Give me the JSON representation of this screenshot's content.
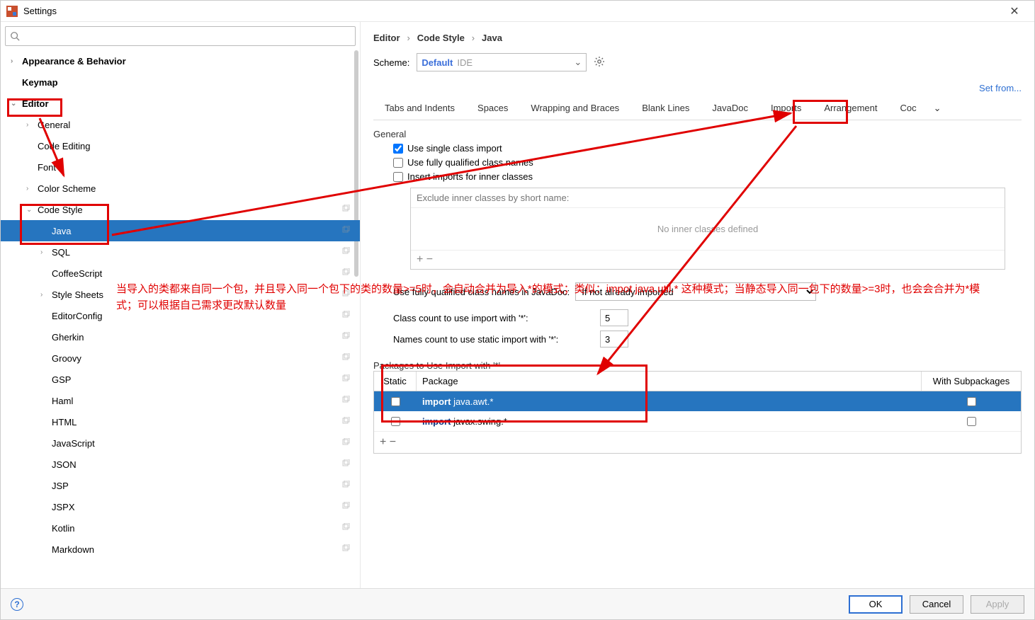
{
  "window": {
    "title": "Settings"
  },
  "search": {
    "placeholder": ""
  },
  "tree": {
    "items": [
      {
        "label": "Appearance & Behavior",
        "indent": 0,
        "chev": "›",
        "bold": true
      },
      {
        "label": "Keymap",
        "indent": 0,
        "chev": "",
        "bold": true
      },
      {
        "label": "Editor",
        "indent": 0,
        "chev": "⌄",
        "bold": true
      },
      {
        "label": "General",
        "indent": 1,
        "chev": "›"
      },
      {
        "label": "Code Editing",
        "indent": 1,
        "chev": ""
      },
      {
        "label": "Font",
        "indent": 1,
        "chev": ""
      },
      {
        "label": "Color Scheme",
        "indent": 1,
        "chev": "›"
      },
      {
        "label": "Code Style",
        "indent": 1,
        "chev": "⌄",
        "copy": true
      },
      {
        "label": "Java",
        "indent": 2,
        "chev": "",
        "selected": true,
        "copy": true
      },
      {
        "label": "SQL",
        "indent": 2,
        "chev": "›",
        "copy": true
      },
      {
        "label": "CoffeeScript",
        "indent": 2,
        "chev": "",
        "copy": true
      },
      {
        "label": "Style Sheets",
        "indent": 2,
        "chev": "›",
        "copy": true
      },
      {
        "label": "EditorConfig",
        "indent": 2,
        "chev": "",
        "copy": true
      },
      {
        "label": "Gherkin",
        "indent": 2,
        "chev": "",
        "copy": true
      },
      {
        "label": "Groovy",
        "indent": 2,
        "chev": "",
        "copy": true
      },
      {
        "label": "GSP",
        "indent": 2,
        "chev": "",
        "copy": true
      },
      {
        "label": "Haml",
        "indent": 2,
        "chev": "",
        "copy": true
      },
      {
        "label": "HTML",
        "indent": 2,
        "chev": "",
        "copy": true
      },
      {
        "label": "JavaScript",
        "indent": 2,
        "chev": "",
        "copy": true
      },
      {
        "label": "JSON",
        "indent": 2,
        "chev": "",
        "copy": true
      },
      {
        "label": "JSP",
        "indent": 2,
        "chev": "",
        "copy": true
      },
      {
        "label": "JSPX",
        "indent": 2,
        "chev": "",
        "copy": true
      },
      {
        "label": "Kotlin",
        "indent": 2,
        "chev": "",
        "copy": true
      },
      {
        "label": "Markdown",
        "indent": 2,
        "chev": "",
        "copy": true
      }
    ]
  },
  "breadcrumb": {
    "a": "Editor",
    "b": "Code Style",
    "c": "Java"
  },
  "scheme": {
    "label": "Scheme:",
    "name": "Default",
    "tag": "IDE"
  },
  "setfrom": "Set from...",
  "tabs": [
    "Tabs and Indents",
    "Spaces",
    "Wrapping and Braces",
    "Blank Lines",
    "JavaDoc",
    "Imports",
    "Arrangement",
    "Coc"
  ],
  "general": {
    "title": "General",
    "opt1": "Use single class import",
    "opt2": "Use fully qualified class names",
    "opt3": "Insert imports for inner classes",
    "excludePlaceholder": "Exclude inner classes by short name:",
    "excludeEmpty": "No inner classes defined",
    "plusminus": "+   −"
  },
  "fq": {
    "label": "Use fully qualified class names in JavaDoc:",
    "value": "If not already imported"
  },
  "counts": {
    "classLabel": "Class count to use import with '*':",
    "classVal": "5",
    "namesLabel": "Names count to use static import with '*':",
    "namesVal": "3"
  },
  "pkg": {
    "title": "Packages to Use Import with '*'",
    "colStatic": "Static",
    "colPkg": "Package",
    "colSub": "With Subpackages",
    "rows": [
      {
        "kw": "import",
        "name": " java.awt.*",
        "sel": true
      },
      {
        "kw": "import",
        "name": " javax.swing.*"
      }
    ],
    "bar": "+   −"
  },
  "footer": {
    "ok": "OK",
    "cancel": "Cancel",
    "apply": "Apply"
  },
  "annotation": {
    "text": "当导入的类都来自同一个包，并且导入同一个包下的类的数量>=5时，会自动合并为导入*的模式；类似：impot java.util.* 这种模式；当静态导入同一包下的数量>=3时，也会会合并为*模式；可以根据自己需求更改默认数量"
  }
}
